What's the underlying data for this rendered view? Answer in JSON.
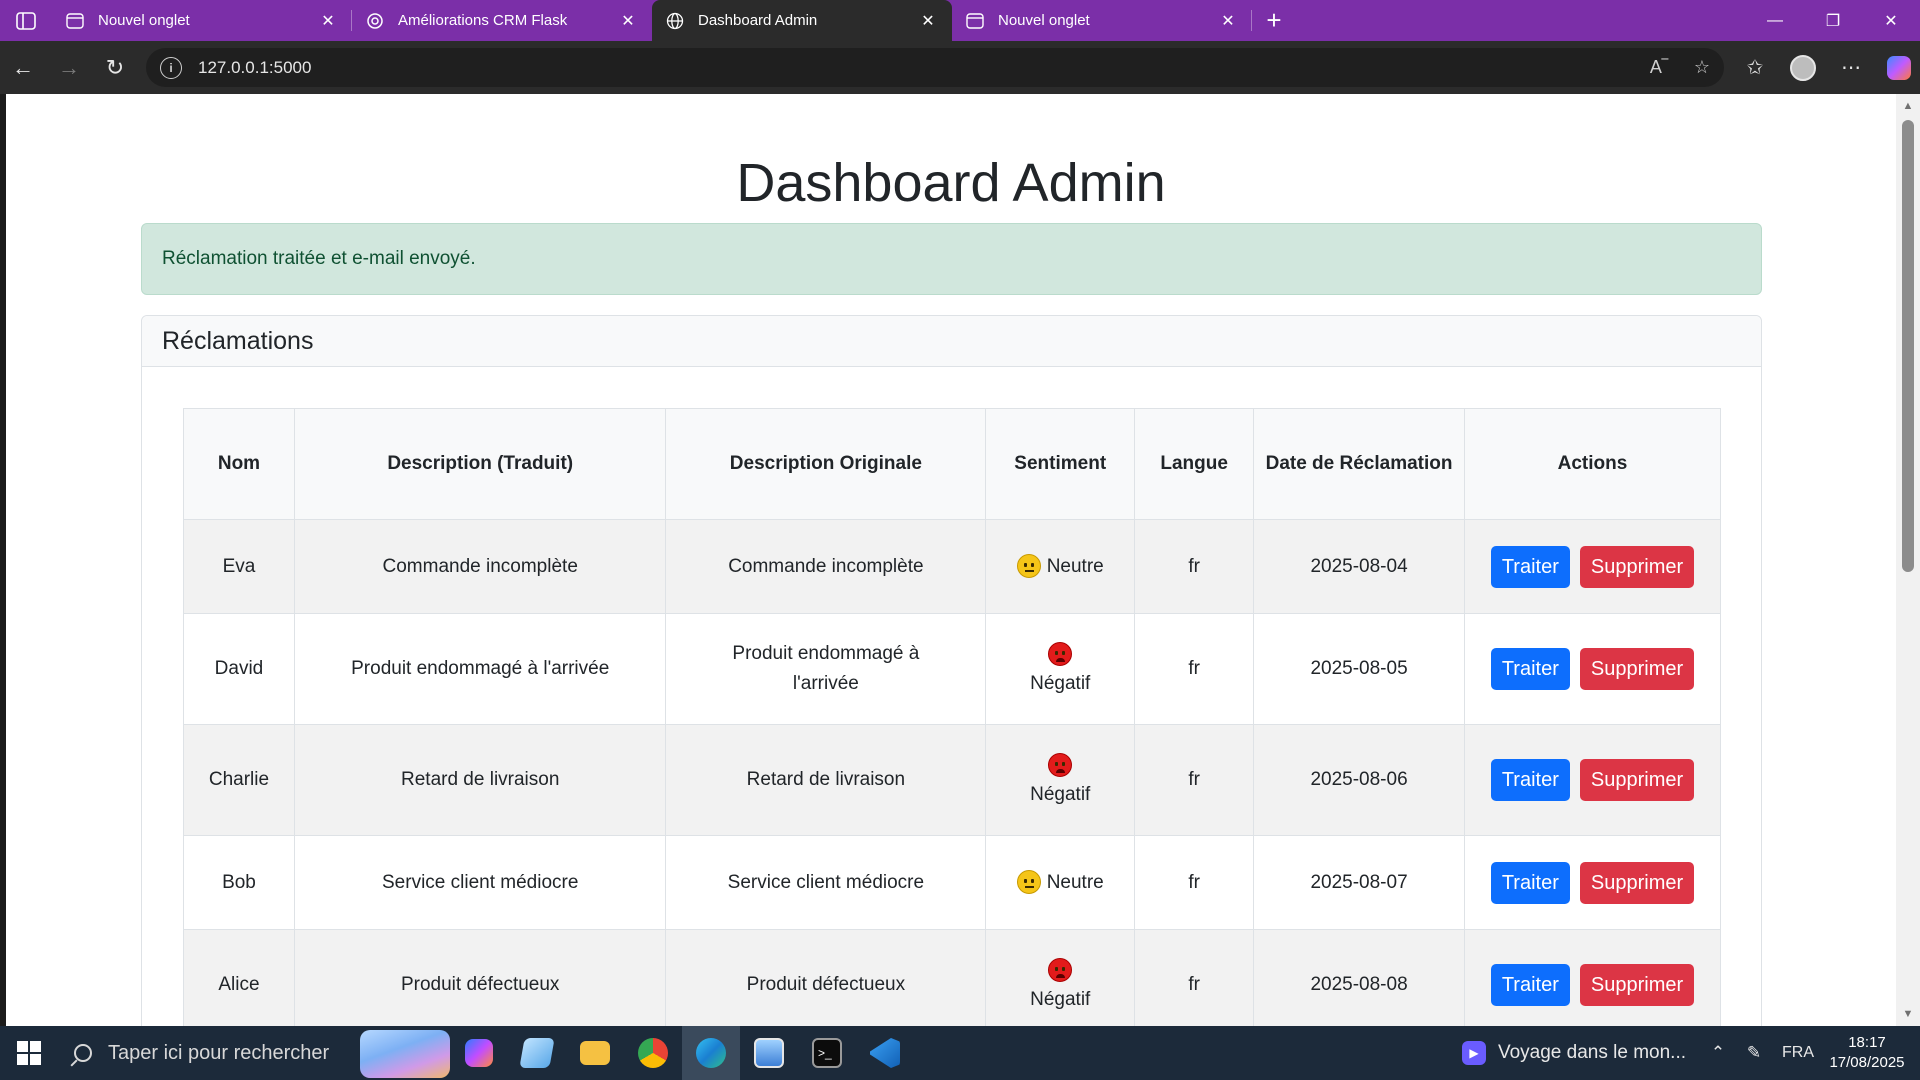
{
  "browser": {
    "tabs": [
      {
        "label": "Nouvel onglet",
        "icon": "new-tab-page-icon",
        "active": false
      },
      {
        "label": "Améliorations CRM Flask",
        "icon": "chatgpt-icon",
        "active": false
      },
      {
        "label": "Dashboard Admin",
        "icon": "globe-icon",
        "active": true
      },
      {
        "label": "Nouvel onglet",
        "icon": "new-tab-page-icon",
        "active": false
      }
    ],
    "close_glyph": "✕",
    "new_tab_glyph": "+",
    "url": "127.0.0.1:5000"
  },
  "page": {
    "title": "Dashboard Admin",
    "alert": "Réclamation traitée et e-mail envoyé.",
    "card_title": "Réclamations",
    "columns": [
      "Nom",
      "Description (Traduit)",
      "Description Originale",
      "Sentiment",
      "Langue",
      "Date de Réclamation",
      "Actions"
    ],
    "treat_label": "Traiter",
    "delete_label": "Supprimer",
    "rows": [
      {
        "nom": "Eva",
        "traduit": "Commande incomplète",
        "originale": "Commande incomplète",
        "sentiment": "Neutre",
        "sentiment_icon": "neutral-face-icon",
        "langue": "fr",
        "date": "2025-08-04"
      },
      {
        "nom": "David",
        "traduit": "Produit endommagé à l'arrivée",
        "originale": "Produit endommagé à l'arrivée",
        "sentiment": "Négatif",
        "sentiment_icon": "angry-face-icon",
        "langue": "fr",
        "date": "2025-08-05"
      },
      {
        "nom": "Charlie",
        "traduit": "Retard de livraison",
        "originale": "Retard de livraison",
        "sentiment": "Négatif",
        "sentiment_icon": "angry-face-icon",
        "langue": "fr",
        "date": "2025-08-06"
      },
      {
        "nom": "Bob",
        "traduit": "Service client médiocre",
        "originale": "Service client médiocre",
        "sentiment": "Neutre",
        "sentiment_icon": "neutral-face-icon",
        "langue": "fr",
        "date": "2025-08-07"
      },
      {
        "nom": "Alice",
        "traduit": "Produit défectueux",
        "originale": "Produit défectueux",
        "sentiment": "Négatif",
        "sentiment_icon": "angry-face-icon",
        "langue": "fr",
        "date": "2025-08-08"
      }
    ]
  },
  "taskbar": {
    "search_placeholder": "Taper ici pour rechercher",
    "media_label": "Voyage dans le mon...",
    "language": "FRA",
    "time": "18:17",
    "date": "17/08/2025"
  },
  "colors": {
    "tabbar": "#7b2fa8",
    "primary": "#0d6efd",
    "danger": "#dc3545",
    "alert_bg": "#d1e7dd"
  }
}
